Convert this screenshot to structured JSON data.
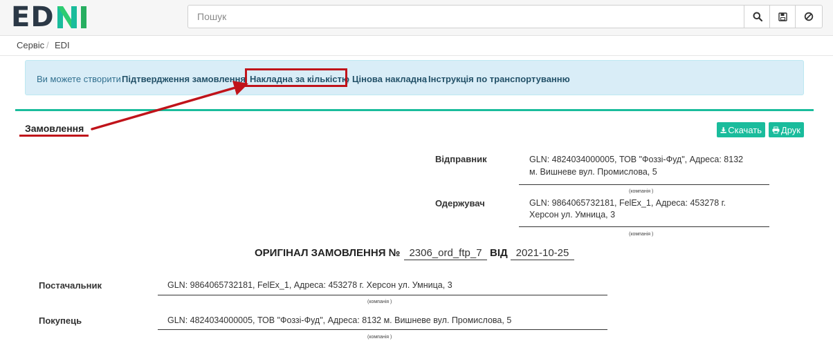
{
  "header": {
    "logo_text": "EDNI",
    "search_placeholder": "Пошук",
    "icons": [
      "search-icon",
      "save-icon",
      "cancel-icon"
    ]
  },
  "breadcrumb": {
    "items": [
      "Сервіс",
      "EDI"
    ],
    "separator": "/"
  },
  "info": {
    "prefix": "Ви можете створити",
    "links": [
      "Підтвердження замовлення",
      "Накладна за кількістю",
      "Цінова накладна",
      "Інструкція по транспортуванню"
    ],
    "comma": ",",
    "highlighted_link": "Накладна за кількістю"
  },
  "panel": {
    "title": "Замовлення",
    "download_label": "Скачать",
    "print_label": "Друк"
  },
  "document": {
    "sender_label": "Відправник",
    "sender_line1": "GLN: 4824034000005, ТОВ \"Фоззі-Фуд\", Адреса: 8132",
    "sender_line2": "м. Вишневе вул. Промислова, 5",
    "company_caption": "(компанія )",
    "receiver_label": "Одержувач",
    "receiver_line1": "GLN: 9864065732181, FelEx_1, Адреса: 453278 г.",
    "receiver_line2": "Херсон ул. Умница, 3",
    "title": "ОРИГІНАЛ ЗАМОВЛЕННЯ №",
    "number": "2306_ord_ftp_7",
    "from_label": "ВІД",
    "date": "2021-10-25",
    "supplier_label": "Постачальник",
    "supplier_value": "GLN: 9864065732181, FelEx_1, Адреса: 453278 г. Херсон ул. Умница, 3",
    "buyer_label": "Покупець",
    "buyer_value": "GLN: 4824034000005, ТОВ \"Фоззі-Фуд\", Адреса: 8132 м. Вишневе вул. Промислова, 5"
  },
  "colors": {
    "accent": "#1abc9c",
    "highlight": "#c0131a",
    "alert_bg": "#d9edf7",
    "link": "#245269"
  }
}
